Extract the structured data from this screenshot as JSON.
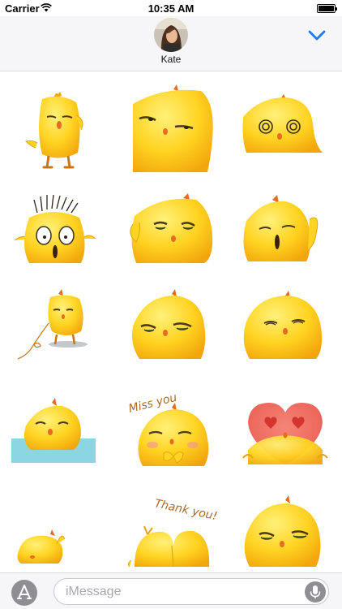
{
  "status_bar": {
    "carrier": "Carrier",
    "time": "10:35 AM",
    "battery_level": 1.0,
    "icons": [
      "wifi-icon",
      "battery-icon"
    ]
  },
  "header": {
    "contact_name": "Kate",
    "icons": [
      "avatar",
      "chevron-down-icon"
    ]
  },
  "stickers": [
    {
      "name": "chick-standing-side-eye"
    },
    {
      "name": "chick-closeup-squint"
    },
    {
      "name": "chick-dizzy-spiral-eyes"
    },
    {
      "name": "chick-shocked-hair-up"
    },
    {
      "name": "chick-scratching-head"
    },
    {
      "name": "chick-whistling"
    },
    {
      "name": "chick-holding-string"
    },
    {
      "name": "chick-unimpressed"
    },
    {
      "name": "chick-content-smile"
    },
    {
      "name": "chick-floating-in-water"
    },
    {
      "name": "chick-miss-you",
      "caption": "Miss you"
    },
    {
      "name": "chick-heart-eyes"
    },
    {
      "name": "chick-lying-down"
    },
    {
      "name": "chick-thank-you-bow",
      "caption": "Thank you!"
    },
    {
      "name": "chick-sleepy-stare"
    }
  ],
  "input_bar": {
    "placeholder": "iMessage",
    "icons": [
      "app-store-icon",
      "microphone-icon"
    ]
  },
  "colors": {
    "accent": "#1a7cf5",
    "chick_body": "#ffd321",
    "chick_shade": "#f0a80f",
    "beak": "#e96a20",
    "caption_brown": "#a66a2a",
    "heart": "#f06a5e",
    "water": "#8cd6e4"
  }
}
